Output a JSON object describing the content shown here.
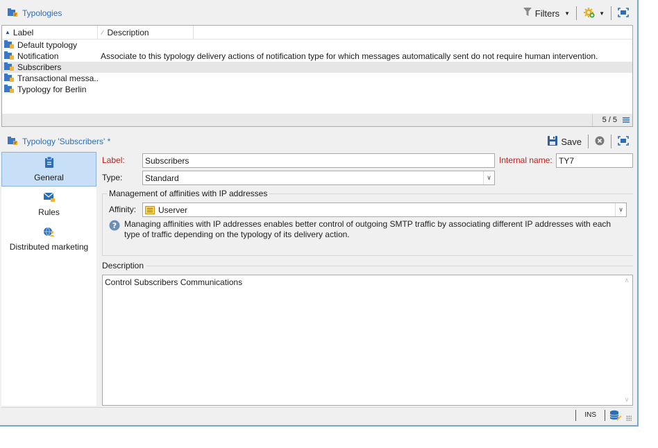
{
  "list_panel": {
    "title": "Typologies",
    "filters_label": "Filters",
    "columns": [
      "Label",
      "Description"
    ],
    "rows": [
      {
        "label": "Default typology",
        "description": ""
      },
      {
        "label": "Notification",
        "description": "Associate to this typology delivery actions of notification type for which messages automatically sent do not require human intervention."
      },
      {
        "label": "Subscribers",
        "description": "",
        "selected": true
      },
      {
        "label": "Transactional messa...",
        "description": ""
      },
      {
        "label": "Typology for Berlin",
        "description": ""
      }
    ],
    "count": "5 / 5"
  },
  "detail_panel": {
    "title": "Typology 'Subscribers' *",
    "save_label": "Save",
    "tabs": [
      {
        "label": "General",
        "icon": "clipboard-icon",
        "active": true
      },
      {
        "label": "Rules",
        "icon": "rules-envelope-icon",
        "active": false
      },
      {
        "label": "Distributed marketing",
        "icon": "globe-user-icon",
        "active": false
      }
    ],
    "form": {
      "label_caption": "Label:",
      "label_value": "Subscribers",
      "internal_name_caption": "Internal name:",
      "internal_name_value": "TY7",
      "type_caption": "Type:",
      "type_value": "Standard",
      "affinities_group_title": "Management of affinities with IP addresses",
      "affinity_caption": "Affinity:",
      "affinity_value": "Userver",
      "affinity_hint": "Managing affinities with IP addresses enables better control of outgoing SMTP traffic by associating different IP addresses with each type of traffic depending on the typology of its delivery action.",
      "description_caption": "Description",
      "description_value": "Control Subscribers Communications"
    }
  },
  "statusbar": {
    "mode": "INS"
  },
  "colors": {
    "accent": "#2a6fb5",
    "required_label": "#c41919",
    "active_tab": "#c7dff7",
    "frame": "#6fa8dc"
  }
}
